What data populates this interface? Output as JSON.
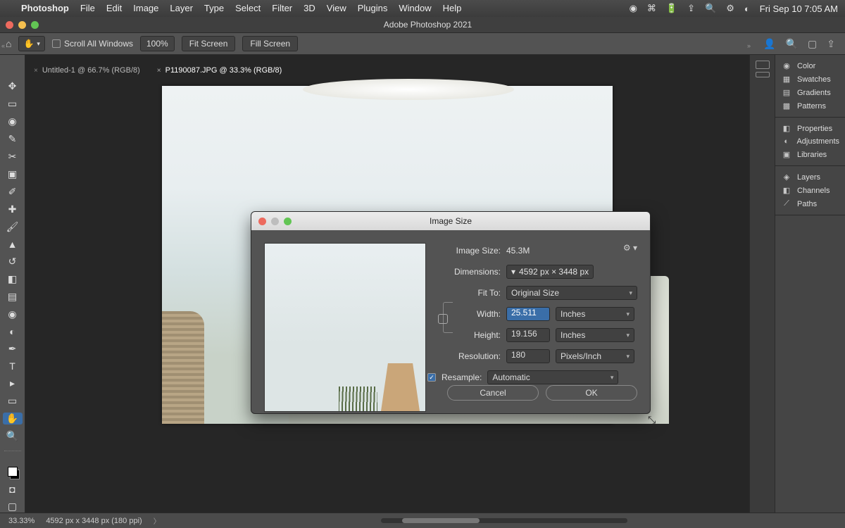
{
  "menubar": {
    "app": "Photoshop",
    "items": [
      "File",
      "Edit",
      "Image",
      "Layer",
      "Type",
      "Select",
      "Filter",
      "3D",
      "View",
      "Plugins",
      "Window",
      "Help"
    ],
    "clock": "Fri Sep 10  7:05 AM"
  },
  "titlebar": {
    "title": "Adobe Photoshop 2021"
  },
  "optionsBar": {
    "scrollAll": "Scroll All Windows",
    "zoom": "100%",
    "fitScreen": "Fit Screen",
    "fillScreen": "Fill Screen"
  },
  "tabs": [
    {
      "label": "Untitled-1 @ 66.7% (RGB/8)",
      "active": false
    },
    {
      "label": "P1190087.JPG @ 33.3% (RGB/8)",
      "active": true
    }
  ],
  "dialog": {
    "title": "Image Size",
    "imageSizeLabel": "Image Size:",
    "imageSize": "45.3M",
    "dimensionsLabel": "Dimensions:",
    "dimensions": "4592 px  ×  3448 px",
    "fitToLabel": "Fit To:",
    "fitTo": "Original Size",
    "widthLabel": "Width:",
    "width": "25.511",
    "widthUnit": "Inches",
    "heightLabel": "Height:",
    "height": "19.156",
    "heightUnit": "Inches",
    "resolutionLabel": "Resolution:",
    "resolution": "180",
    "resolutionUnit": "Pixels/Inch",
    "resampleLabel": "Resample:",
    "resample": "Automatic",
    "cancel": "Cancel",
    "ok": "OK"
  },
  "panels": {
    "g1": [
      "Color",
      "Swatches",
      "Gradients",
      "Patterns"
    ],
    "g2": [
      "Properties",
      "Adjustments",
      "Libraries"
    ],
    "g3": [
      "Layers",
      "Channels",
      "Paths"
    ]
  },
  "status": {
    "zoom": "33.33%",
    "dims": "4592 px x 3448 px (180 ppi)"
  }
}
